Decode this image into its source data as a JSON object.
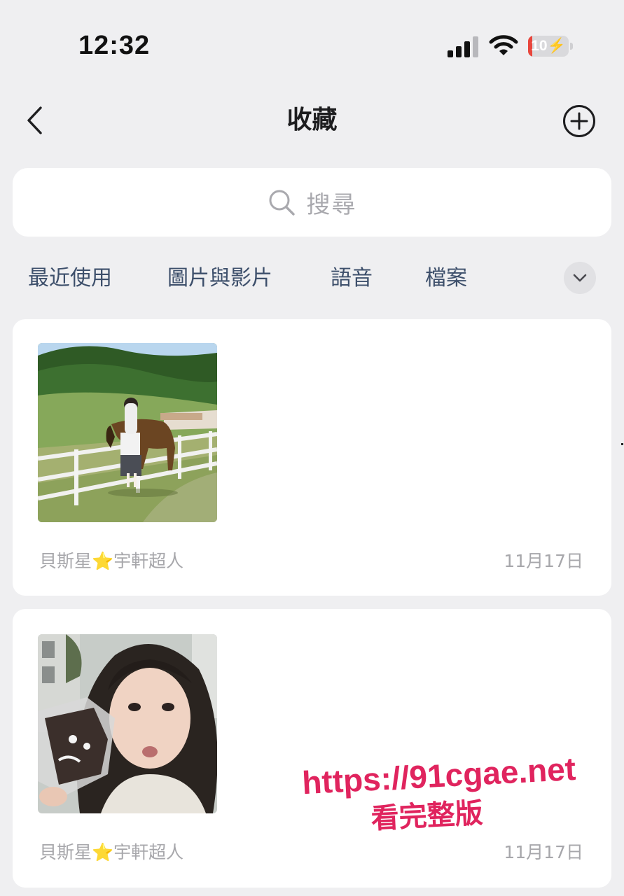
{
  "status_bar": {
    "time": "12:32",
    "battery_level": "10",
    "battery_fraction": 0.1,
    "icons": [
      "signal-icon",
      "wifi-icon",
      "battery-charging-icon"
    ],
    "battery_color": "#e8463c"
  },
  "nav": {
    "title": "收藏",
    "back_icon": "chevron-left-icon",
    "add_icon": "plus-circle-icon"
  },
  "search": {
    "placeholder": "搜尋",
    "icon": "search-icon"
  },
  "tabs": [
    {
      "label": "最近使用"
    },
    {
      "label": "圖片與影片"
    },
    {
      "label": "語音"
    },
    {
      "label": "檔案"
    }
  ],
  "tabs_expand_icon": "chevron-down-icon",
  "items": [
    {
      "thumbnail": "photo: girl standing by a white fence with a brown horse on a green hillside ranch",
      "source": "貝斯星⭐宇軒超人",
      "date": "11月17日"
    },
    {
      "thumbnail": "photo: girl with long dark hair holding a small plush toy close to her face",
      "source": "貝斯星⭐宇軒超人",
      "date": "11月17日"
    }
  ],
  "watermark": {
    "url": "https://91cgae.net",
    "text": "看完整版",
    "color": "#e0245e"
  },
  "colors": {
    "background": "#efeff1",
    "card": "#ffffff",
    "tab_text": "#3d4f6b",
    "meta_text": "#a7a7ab"
  }
}
